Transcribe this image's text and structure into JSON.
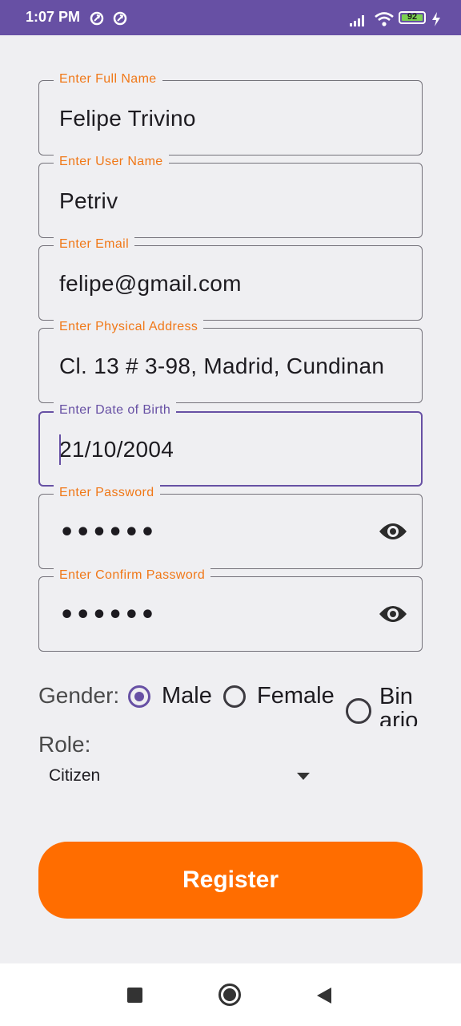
{
  "status_bar": {
    "time": "1:07 PM",
    "battery": "92",
    "battery_level": 0.92,
    "icons": [
      "notification-icon",
      "notification-icon",
      "signal-icon",
      "wifi-icon",
      "battery-icon",
      "charging-icon"
    ]
  },
  "fields": {
    "full_name": {
      "label": "Enter Full Name",
      "value": "Felipe Trivino"
    },
    "user_name": {
      "label": "Enter User Name",
      "value": "Petriv"
    },
    "email": {
      "label": "Enter Email",
      "value": "felipe@gmail.com"
    },
    "address": {
      "label": "Enter Physical Address",
      "value": "Cl. 13 # 3-98, Madrid, Cundinan"
    },
    "dob": {
      "label": "Enter Date of Birth",
      "value": "21/10/2004"
    },
    "password": {
      "label": "Enter Password",
      "value": "••••••"
    },
    "confirm_password": {
      "label": "Enter Confirm Password",
      "value": "••••••"
    }
  },
  "gender": {
    "label": "Gender:",
    "options": [
      "Male",
      "Female",
      "Bin",
      "ario"
    ],
    "selected": "Male"
  },
  "role": {
    "label": "Role:",
    "value": "Citizen"
  },
  "register_label": "Register",
  "colors": {
    "primary": "#6750a4",
    "accent": "#ff6d00",
    "label": "#f07818",
    "background": "#efeff2"
  }
}
